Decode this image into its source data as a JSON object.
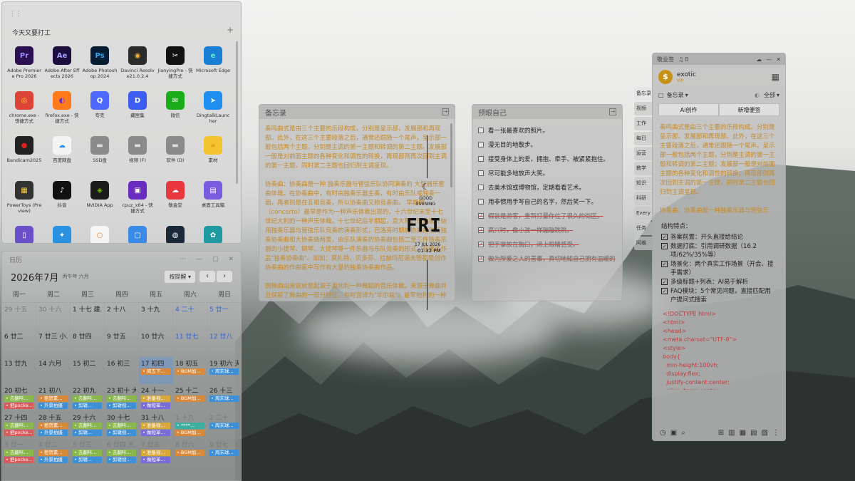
{
  "launcher": {
    "group_title": "今天又要打工",
    "apps": [
      {
        "label": "Adobe Premiere Pro 2026",
        "icon": "Pr",
        "color": "#2a1050",
        "fg": "#9d8bff"
      },
      {
        "label": "Adobe After Effects 2026",
        "icon": "Ae",
        "color": "#1c0f40",
        "fg": "#a7a0ff"
      },
      {
        "label": "Adobe Photoshop 2024",
        "icon": "Ps",
        "color": "#061c33",
        "fg": "#31a8ff"
      },
      {
        "label": "Davinci Resolve21.0.2.4",
        "icon": "◉",
        "color": "#2b2b2b",
        "fg": "#f0b030"
      },
      {
        "label": "JianyingPro - 快捷方式",
        "icon": "✂",
        "color": "#111111",
        "fg": "#ffffff"
      },
      {
        "label": "Microsoft Edge",
        "icon": "e",
        "color": "#1a7fd4",
        "fg": "#5ff0c0"
      },
      {
        "label": "chrome.exe - 快捷方式",
        "icon": "◎",
        "color": "#db4437",
        "fg": "#fbd040"
      },
      {
        "label": "firefox.exe - 快捷方式",
        "icon": "◐",
        "color": "#ff7a1a",
        "fg": "#6a2cc0"
      },
      {
        "label": "夸克",
        "icon": "Q",
        "color": "#4f68ff",
        "fg": "#ffffff"
      },
      {
        "label": "藏匣集",
        "icon": "D",
        "color": "#3d5cf0",
        "fg": "#ffffff"
      },
      {
        "label": "微信",
        "icon": "✉",
        "color": "#1aad19",
        "fg": "#ffffff"
      },
      {
        "label": "DingtalkLauncher",
        "icon": "➤",
        "color": "#1e8ef0",
        "fg": "#ffffff"
      },
      {
        "label": "Bandicam2025",
        "icon": "●",
        "color": "#222222",
        "fg": "#e02020"
      },
      {
        "label": "百度网盘",
        "icon": "☁",
        "color": "#f4f4f4",
        "fg": "#2b8cf0"
      },
      {
        "label": "SSD盘",
        "icon": "▬",
        "color": "#8a8a8a",
        "fg": "#dddddd"
      },
      {
        "label": "视频 (F)",
        "icon": "▬",
        "color": "#8a8a8a",
        "fg": "#dddddd"
      },
      {
        "label": "软件 (D)",
        "icon": "▬",
        "color": "#8a8a8a",
        "fg": "#dddddd"
      },
      {
        "label": "素材",
        "icon": "▰",
        "color": "#f4c430",
        "fg": "#e8a810"
      },
      {
        "label": "PowerToys (Preview)",
        "icon": "▦",
        "color": "#333333",
        "fg": "#ffd040"
      },
      {
        "label": "抖音",
        "icon": "♪",
        "color": "#111111",
        "fg": "#ffffff"
      },
      {
        "label": "NVIDIA App",
        "icon": "◈",
        "color": "#1b1b1b",
        "fg": "#76b900"
      },
      {
        "label": "cpuz_x64 - 快捷方式",
        "icon": "▣",
        "color": "#6a2bc0",
        "fg": "#ffffff"
      },
      {
        "label": "敬金堂",
        "icon": "☁",
        "color": "#e8383d",
        "fg": "#ffffff"
      },
      {
        "label": "桌面工具箱",
        "icon": "▤",
        "color": "#7a5ce0",
        "fg": "#ffffff"
      },
      {
        "label": "",
        "icon": "▯",
        "color": "#6a50c8",
        "fg": "#ffffff"
      },
      {
        "label": "",
        "icon": "✦",
        "color": "#2a90e0",
        "fg": "#ffffff"
      },
      {
        "label": "",
        "icon": "○",
        "color": "#f5f5f5",
        "fg": "#f07a20"
      },
      {
        "label": "",
        "icon": "▢",
        "color": "#3a8ae8",
        "fg": "#ffffff"
      },
      {
        "label": "",
        "icon": "◍",
        "color": "#1b2838",
        "fg": "#ffffff"
      },
      {
        "label": "",
        "icon": "✿",
        "color": "#1f9aa0",
        "fg": "#ffffff"
      }
    ]
  },
  "calendar": {
    "title": "日历",
    "month": "2026年7月",
    "lunar": "丙午年 六月",
    "view_select": "按提醒",
    "weekdays": [
      "周一",
      "周二",
      "周三",
      "周四",
      "周五",
      "周六",
      "周日"
    ],
    "weeks": [
      [
        {
          "d": "29 十五",
          "o": true
        },
        {
          "d": "30 十六",
          "o": true
        },
        {
          "d": "1 十七 建...",
          "o": false
        },
        {
          "d": "2 十八",
          "o": false
        },
        {
          "d": "3 十九",
          "o": false
        },
        {
          "d": "4 二十",
          "o": false,
          "b": true
        },
        {
          "d": "5 廿一",
          "o": false,
          "b": true
        }
      ],
      [
        {
          "d": "6 廿二"
        },
        {
          "d": "7 廿三 小..."
        },
        {
          "d": "8 廿四"
        },
        {
          "d": "9 廿五"
        },
        {
          "d": "10 廿六"
        },
        {
          "d": "11 廿七",
          "b": true
        },
        {
          "d": "12 廿八",
          "b": true
        }
      ],
      [
        {
          "d": "13 廿九"
        },
        {
          "d": "14 六月"
        },
        {
          "d": "15 初二"
        },
        {
          "d": "16 初三"
        },
        {
          "d": "17 初四",
          "today": true,
          "ev": [
            [
              "周五下...",
              "#d9893a"
            ]
          ]
        },
        {
          "d": "18 初五",
          "ev": [
            [
              "BGM加...",
              "#d9893a"
            ]
          ]
        },
        {
          "d": "19 初六 天...",
          "ev": [
            [
              "周末球...",
              "#3d8fd8"
            ]
          ]
        }
      ],
      [
        {
          "d": "20 初七",
          "ev": [
            [
              "去翻咔...",
              "#8ab84a"
            ],
            [
              "把pocke...",
              "#d85a5a"
            ]
          ]
        },
        {
          "d": "21 初八",
          "ev": [
            [
              "租贺素...",
              "#d9893a"
            ],
            [
              "外景拍摄",
              "#3d8fd8"
            ]
          ]
        },
        {
          "d": "22 初九",
          "ev": [
            [
              "去翻咔...",
              "#8ab84a"
            ],
            [
              "剪辑...",
              "#3d8fd8"
            ]
          ]
        },
        {
          "d": "23 初十 大...",
          "ev": [
            [
              "去翻咔...",
              "#8ab84a"
            ],
            [
              "剪辑视...",
              "#3d8fd8"
            ]
          ]
        },
        {
          "d": "24 十一",
          "ev": [
            [
              "准备视...",
              "#d9a83a"
            ],
            [
              "做短革...",
              "#7a6cd8"
            ]
          ]
        },
        {
          "d": "25 十二",
          "ev": [
            [
              "BGM加...",
              "#d9893a"
            ]
          ]
        },
        {
          "d": "26 十三",
          "ev": [
            [
              "周末球...",
              "#3d8fd8"
            ]
          ]
        }
      ],
      [
        {
          "d": "27 十四",
          "ev": [
            [
              "去翻咔...",
              "#8ab84a"
            ],
            [
              "把pocke...",
              "#d85a5a"
            ]
          ]
        },
        {
          "d": "28 十五",
          "ev": [
            [
              "租贺素...",
              "#d9893a"
            ],
            [
              "外景拍摄",
              "#3d8fd8"
            ]
          ]
        },
        {
          "d": "29 十六",
          "ev": [
            [
              "去翻咔...",
              "#8ab84a"
            ],
            [
              "剪辑...",
              "#3d8fd8"
            ]
          ]
        },
        {
          "d": "30 十七",
          "ev": [
            [
              "去翻咔...",
              "#8ab84a"
            ],
            [
              "剪辑视...",
              "#3d8fd8"
            ]
          ]
        },
        {
          "d": "31 十八",
          "ev": [
            [
              "准备视...",
              "#d9a83a"
            ],
            [
              "做短革...",
              "#7a6cd8"
            ]
          ]
        },
        {
          "d": "1 十九",
          "o": true,
          "ev": [
            [
              "****...",
              "#3dafa0"
            ],
            [
              "BGM加...",
              "#d9893a"
            ]
          ]
        },
        {
          "d": "2 二十",
          "o": true,
          "ev": [
            [
              "周末球...",
              "#3d8fd8"
            ]
          ]
        }
      ],
      [
        {
          "d": "3 廿一",
          "o": true,
          "ev": [
            [
              "去翻咔...",
              "#8ab84a"
            ],
            [
              "把pocke...",
              "#d85a5a"
            ]
          ]
        },
        {
          "d": "4 廿二",
          "o": true,
          "ev": [
            [
              "租贺素...",
              "#d9893a"
            ],
            [
              "外景拍摄",
              "#3d8fd8"
            ]
          ]
        },
        {
          "d": "5 廿三",
          "o": true,
          "ev": [
            [
              "去翻咔...",
              "#8ab84a"
            ],
            [
              "剪辑...",
              "#3d8fd8"
            ]
          ]
        },
        {
          "d": "6 廿四 大...",
          "o": true,
          "ev": [
            [
              "去翻咔...",
              "#8ab84a"
            ],
            [
              "剪辑视...",
              "#3d8fd8"
            ]
          ]
        },
        {
          "d": "7 廿五",
          "o": true,
          "ev": [
            [
              "准备视...",
              "#d9a83a"
            ],
            [
              "做短革...",
              "#7a6cd8"
            ]
          ]
        },
        {
          "d": "8 廿六",
          "o": true,
          "ev": [
            [
              "BGM加...",
              "#d9893a"
            ]
          ]
        },
        {
          "d": "9 廿七",
          "o": true,
          "ev": [
            [
              "周末球...",
              "#3d8fd8"
            ]
          ]
        }
      ]
    ]
  },
  "memo": {
    "title": "备忘录",
    "paragraphs": [
      "奏鸣曲式是由三个主要的乐段构成，分别是呈示部、发展部和再现部。此外，在这三个主要段落之后，通常还跟随一个尾声，呈示部一般包括两个主题，分别是主调的第一主题和转调的第二主题。发展部一般是对前面主题的各种变化和调性的转换，再现部则再次回到主调的第一主题，同时第二主题也回归到主调呈现。",
      "协奏曲：协奏曲是一种 独奏乐器与管弦乐队协同演奏的 大型器乐套曲体裁。在协奏曲中，有时由独奏乐器主奏，有时由乐队或独奏一面，再者则是在互相竞奏，所以协奏曲又称竞奏曲。 早期的（concerto）最早是作为一种声乐体裁出现的，十六世纪末至十七世纪大利的一种声乐体裁。十七世纪后半期起，意大利的作曲家开始用独奏乐器与管弦乐队竞奏的演奏形式，巴洛克时期的协奏曲包括独奏协奏曲和大协奏曲两类，由乐队演奏的协奏曲包括二至三件独奏乐器的小提琴、钢琴、大提琴等一件乐器与乐队竞奏的形式。在著名作品\"独奏协奏曲\"。如如：莫扎特、贝多芬、拉赫玛尼诺夫等都是创作协奏曲的作曲家中写作有大量的独奏协奏曲作品。",
      "圆舞曲由来说就是起源于奥地利一种舞蹈的音乐体裁。来源于舞曲并且保留了舞曲的一部分特征。有时音译为\"华尔兹\"。最早地利的一种民间舞曲。18世纪后半叶用于社交舞会，19世纪开始流行于"
    ]
  },
  "todo": {
    "title": "预眼自己",
    "items": [
      {
        "text": "看一张最喜欢的照片。",
        "done": false
      },
      {
        "text": "漫无目的地散步。",
        "done": false
      },
      {
        "text": "接受身体上的爱，拥抱、牵手、被紧紧抱住。",
        "done": false
      },
      {
        "text": "尽可能多地放声大笑。",
        "done": false
      },
      {
        "text": "去美术馆或博物馆，定期看看艺术。",
        "done": false
      },
      {
        "text": "用非惯用手写自己的名字，然后笑一下。",
        "done": false
      },
      {
        "text": "假装是游客，重新打量你住了很久的街区。",
        "done": true
      },
      {
        "text": "高兴时，像小孩一样蹦蹦跳跳。",
        "done": true
      },
      {
        "text": "把手掌放在胸口，闭上眼睛感受。",
        "done": true
      },
      {
        "text": "做为所爱之人的善事，真切地知自己拥有温暖的",
        "done": true
      }
    ]
  },
  "clock": {
    "greeting_line1": "GOOD",
    "greeting_line2": "EVENING",
    "day": "FRI",
    "date": "17 JUL 2026",
    "time": "01:32 PM"
  },
  "notes_app": {
    "title": "敬业签",
    "badge_count": "0",
    "user_name": "exotic",
    "vip_label": "VIP",
    "category": "备忘录",
    "filter": "全部",
    "btn_ai": "Ai创作",
    "btn_new": "新增便签",
    "side_tabs": [
      "备忘录",
      "视频",
      "工作",
      "每日",
      "运营",
      "教学",
      "知识",
      "科研",
      "Every",
      "任务",
      "阿维"
    ],
    "orange_text": "奏鸣曲式是由三个主要的乐段构成。分别是呈示部、发展部和再现部。此外，在这三个主要段落之后，通常还跟随一个尾声。呈示部一般包括两个主题，分别是主调的第一主题和转调的第二主题；发展部一般是对前面主题的各种变化和调性的转换；再现部则再次回到主调的第一主题，同时第二主题也回归到主调呈现。",
    "orange_tail": "协奏曲：协奏曲是一种独奏乐器与管弦乐",
    "struct_title": "结构特点：",
    "struct_items": [
      "答案前置：开头直接给结论",
      "数据打底：引用调研数据（16.2项/62%/35%等）",
      "场景化：两个真实工作场景（开会、接手需求）",
      "多级标题+列表：AI易于解析",
      "FAQ模块：5个常见问题，直接匹配用户提问式搜索",
      "事实可引：不同观点中，增强可信度"
    ],
    "code_lines": [
      "<!DOCTYPE html>",
      "<html>",
      "<head>",
      "<meta charset=\"UTF-8\">",
      "<style>",
      "body{",
      "  min-height:100vh;",
      "  display:flex;",
      "  justify-content:center;",
      "  align-items:center;"
    ]
  }
}
